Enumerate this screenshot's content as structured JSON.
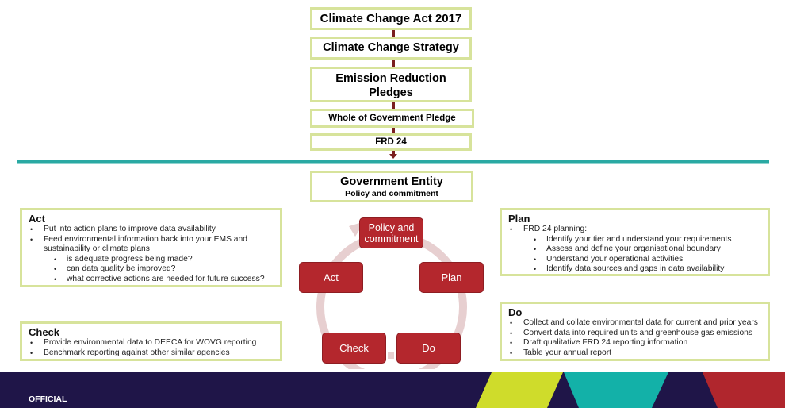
{
  "hierarchy": {
    "act": "Climate Change Act 2017",
    "strategy": "Climate Change Strategy",
    "pledges_line1": "Emission Reduction",
    "pledges_line2": "Pledges",
    "wog": "Whole of Government Pledge",
    "frd": "FRD 24"
  },
  "entity": {
    "title": "Government Entity",
    "subtitle": "Policy and commitment"
  },
  "cycle": {
    "policy_line1": "Policy and",
    "policy_line2": "commitment",
    "plan": "Plan",
    "do": "Do",
    "check": "Check",
    "act": "Act"
  },
  "panels": {
    "act": {
      "title": "Act",
      "items": [
        "Put into action plans to improve data availability",
        "Feed environmental information back into your EMS and sustainability or climate plans",
        "is adequate progress being made?",
        "can data quality be improved?",
        "what corrective actions are needed for future success?"
      ]
    },
    "check": {
      "title": "Check",
      "items": [
        "Provide environmental data to DEECA for WOVG reporting",
        "Benchmark reporting against other similar agencies"
      ]
    },
    "plan": {
      "title": "Plan",
      "items": [
        "FRD 24 planning:",
        "Identify your tier and understand your requirements",
        "Assess and define your organisational boundary",
        "Understand your operational activities",
        "Identify data sources and gaps in data availability"
      ]
    },
    "do": {
      "title": "Do",
      "items": [
        "Collect and collate environmental data for current and prior years",
        "Convert data into required units and greenhouse gas emissions",
        "Draft qualitative FRD 24 reporting information",
        "Table your annual report"
      ]
    }
  },
  "footer": {
    "classification": "OFFICIAL"
  },
  "colors": {
    "box_border": "#d7e39b",
    "connector": "#7a1f1f",
    "separator": "#2aa9a3",
    "cycle_fill": "#b4272d",
    "cycle_ring": "#e7cfd0",
    "footer_navy": "#1f1548",
    "footer_lime": "#cfdc2b",
    "footer_teal": "#13b1a8",
    "footer_red": "#b0262d"
  }
}
